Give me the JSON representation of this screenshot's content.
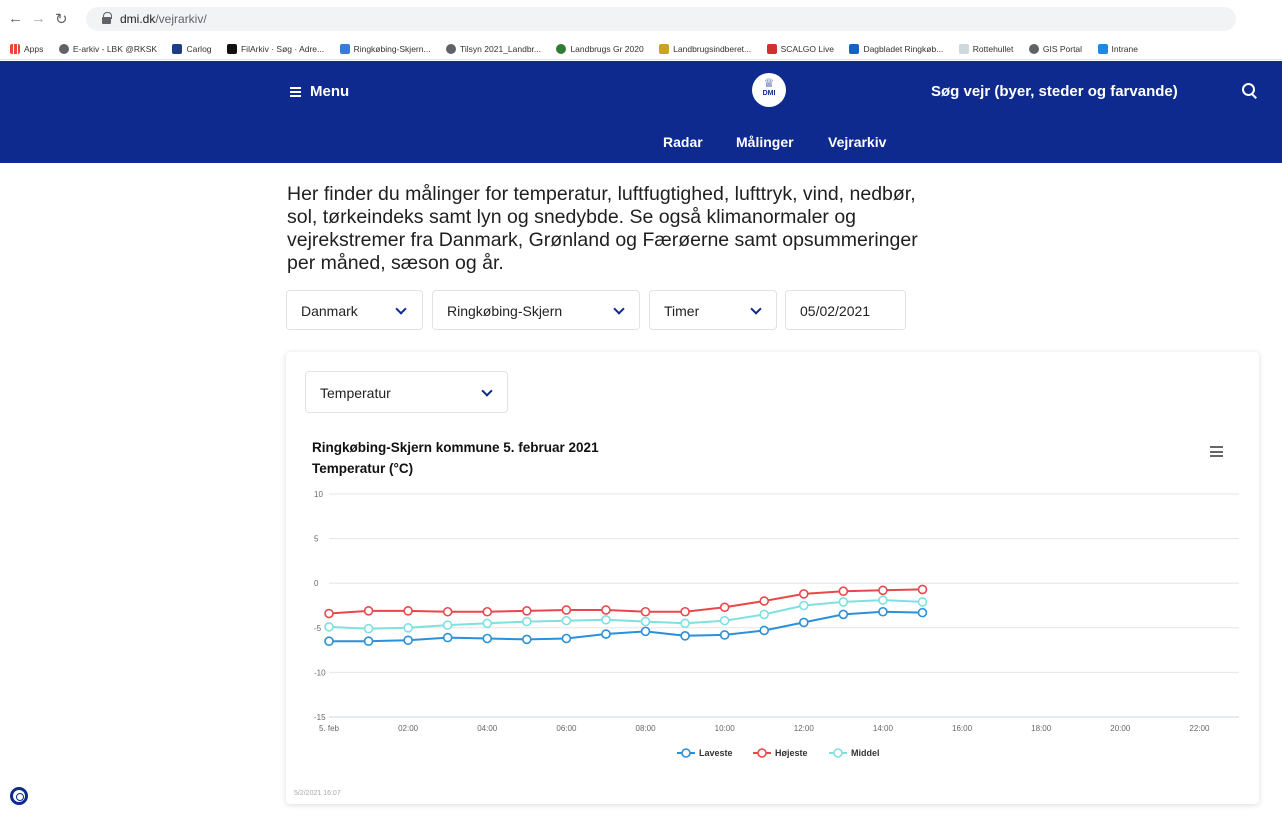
{
  "browser": {
    "url_host": "dmi.dk",
    "url_path": "/vejrarkiv/",
    "bookmarks": [
      "Apps",
      "E-arkiv - LBK @RKSK",
      "Carlog",
      "FilArkiv · Søg · Adre...",
      "Ringkøbing-Skjern...",
      "Tilsyn 2021_Landbr...",
      "Landbrugs Gr 2020",
      "Landbrugsindberet...",
      "SCALGO Live",
      "Dagbladet Ringkøb...",
      "Rottehullet",
      "GIS Portal",
      "Intrane"
    ]
  },
  "header": {
    "menu_label": "Menu",
    "logo_text": "DMI",
    "search_label": "Søg vejr (byer, steder og farvande)",
    "nav": [
      "Radar",
      "Målinger",
      "Vejrarkiv"
    ]
  },
  "intro_text": "Her finder du målinger for temperatur, luftfugtighed, lufttryk, vind, nedbør, sol, tørkeindeks samt lyn og snedybde. Se også klimanormaler og vejrekstremer fra Danmark, Grønland og Færøerne samt opsummeringer per måned, sæson og år.",
  "filters": {
    "country": "Danmark",
    "municipality": "Ringkøbing-Skjern",
    "resolution": "Timer",
    "date": "05/02/2021"
  },
  "parameter_select": "Temperatur",
  "chart_timestamp": "5/2/2021 16:07",
  "colors": {
    "header_blue": "#0e2a8e",
    "laveste": "#2b8fd9",
    "hojeste": "#e8484b",
    "middel": "#7fe0e0"
  },
  "chart_data": {
    "type": "line",
    "title": "Ringkøbing-Skjern kommune 5. februar 2021",
    "subtitle": "Temperatur (°C)",
    "x": [
      0,
      1,
      2,
      3,
      4,
      5,
      6,
      7,
      8,
      9,
      10,
      11,
      12,
      13,
      14,
      15
    ],
    "x_ticks": [
      "5. feb",
      "02:00",
      "04:00",
      "06:00",
      "08:00",
      "10:00",
      "12:00",
      "14:00",
      "16:00",
      "18:00",
      "20:00",
      "22:00"
    ],
    "y_ticks": [
      "10",
      "5",
      "0",
      "-5",
      "-10",
      "-15"
    ],
    "xlim": [
      0,
      23
    ],
    "ylim": [
      -15,
      10
    ],
    "grid": true,
    "legend_position": "bottom-center",
    "series": [
      {
        "name": "Laveste",
        "values": [
          -6.5,
          -6.5,
          -6.4,
          -6.1,
          -6.2,
          -6.3,
          -6.2,
          -5.7,
          -5.4,
          -5.9,
          -5.8,
          -5.3,
          -4.4,
          -3.5,
          -3.2,
          -3.3
        ]
      },
      {
        "name": "Højeste",
        "values": [
          -3.4,
          -3.1,
          -3.1,
          -3.2,
          -3.2,
          -3.1,
          -3.0,
          -3.0,
          -3.2,
          -3.2,
          -2.7,
          -2.0,
          -1.2,
          -0.9,
          -0.8,
          -0.7
        ]
      },
      {
        "name": "Middel",
        "values": [
          -4.9,
          -5.1,
          -5.0,
          -4.7,
          -4.5,
          -4.3,
          -4.2,
          -4.1,
          -4.3,
          -4.5,
          -4.2,
          -3.5,
          -2.5,
          -2.1,
          -1.9,
          -2.1
        ]
      }
    ]
  }
}
